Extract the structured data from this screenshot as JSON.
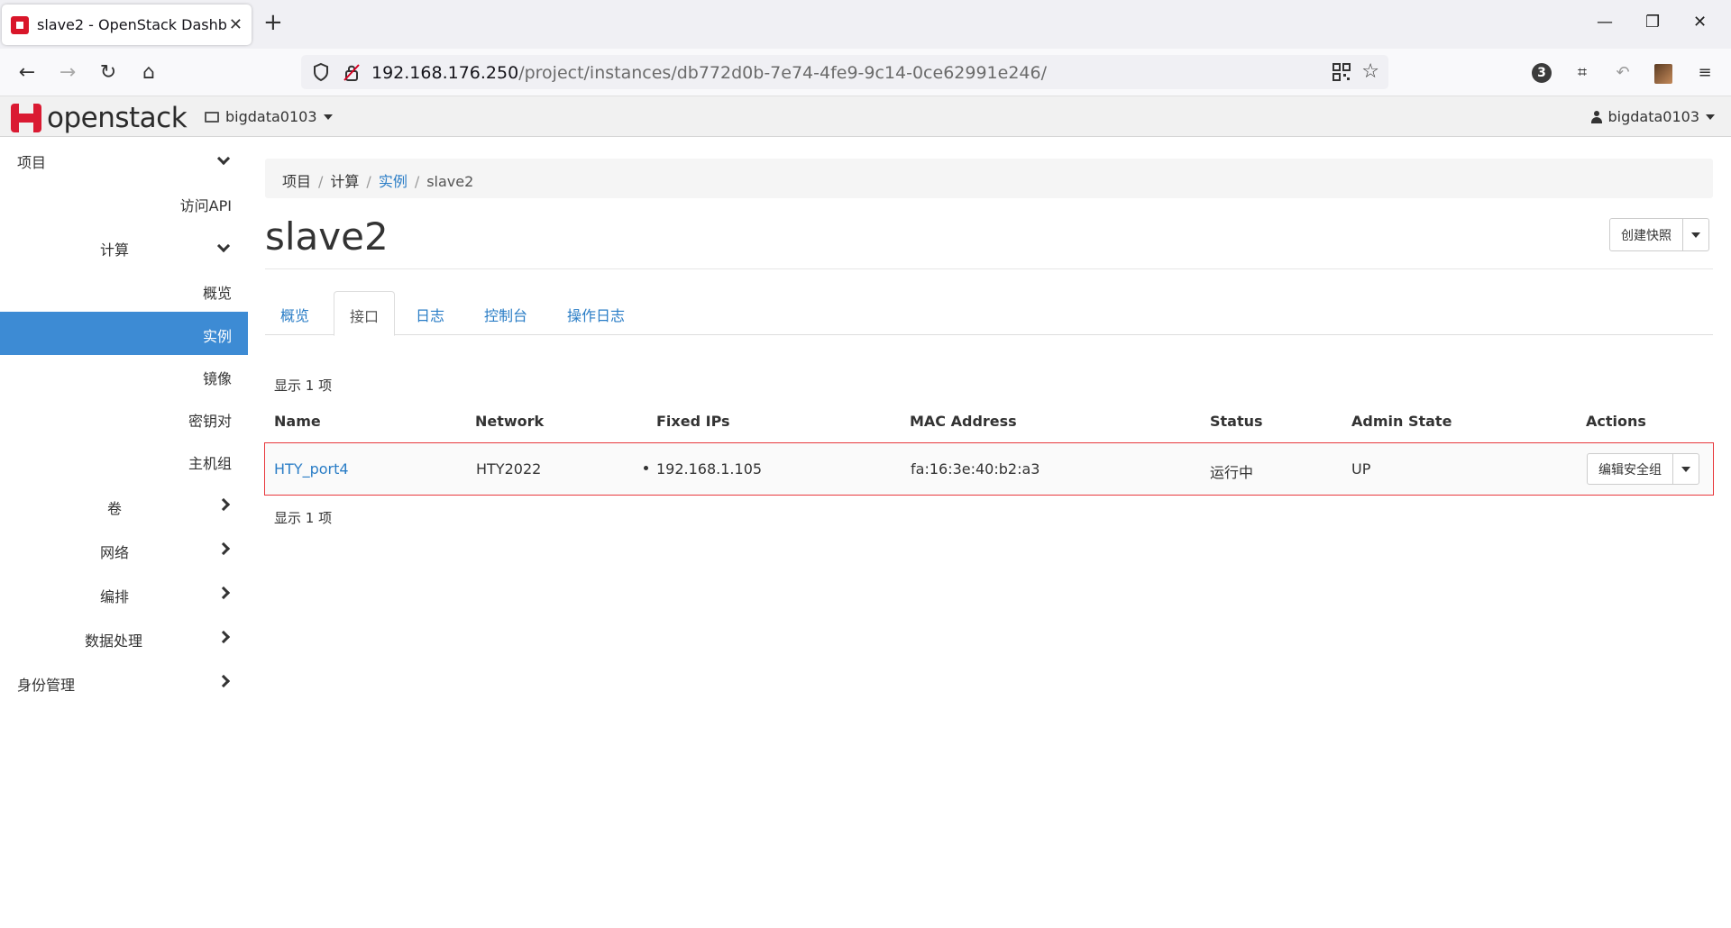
{
  "browser": {
    "tab_title": "slave2 - OpenStack Dashboard",
    "url_host": "192.168.176.250",
    "url_path": "/project/instances/db772d0b-7e74-4fe9-9c14-0ce62991e246/",
    "extension_badge": "3"
  },
  "header": {
    "logo_text": "openstack",
    "project": "bigdata0103",
    "user": "bigdata0103"
  },
  "sidebar": {
    "items": [
      {
        "label": "项目",
        "level": 0,
        "icon": "chevron-down-icon"
      },
      {
        "label": "访问API",
        "level": 2
      },
      {
        "label": "计算",
        "level": 1,
        "icon": "chevron-down-icon"
      },
      {
        "label": "概览",
        "level": 2
      },
      {
        "label": "实例",
        "level": 2,
        "active": true
      },
      {
        "label": "镜像",
        "level": 2
      },
      {
        "label": "密钥对",
        "level": 2
      },
      {
        "label": "主机组",
        "level": 2
      },
      {
        "label": "卷",
        "level": 1,
        "icon": "chevron-right-icon"
      },
      {
        "label": "网络",
        "level": 1,
        "icon": "chevron-right-icon"
      },
      {
        "label": "编排",
        "level": 1,
        "icon": "chevron-right-icon"
      },
      {
        "label": "数据处理",
        "level": 1,
        "icon": "chevron-right-icon"
      },
      {
        "label": "身份管理",
        "level": 0,
        "icon": "chevron-right-icon"
      }
    ]
  },
  "breadcrumb": [
    "项目",
    "计算",
    "实例",
    "slave2"
  ],
  "page": {
    "title": "slave2",
    "snapshot_button": "创建快照"
  },
  "tabs": [
    "概览",
    "接口",
    "日志",
    "控制台",
    "操作日志"
  ],
  "active_tab": "接口",
  "table": {
    "count_top": "显示 1 项",
    "count_bottom": "显示 1 项",
    "columns": [
      "Name",
      "Network",
      "Fixed IPs",
      "MAC Address",
      "Status",
      "Admin State",
      "Actions"
    ],
    "rows": [
      {
        "name": "HTY_port4",
        "network": "HTY2022",
        "fixed_ip": "192.168.1.105",
        "mac": "fa:16:3e:40:b2:a3",
        "status": "运行中",
        "admin_state": "UP",
        "action": "编辑安全组"
      }
    ]
  },
  "colors": {
    "accent": "#3d8bd4",
    "link": "#2a7dc6",
    "highlight_border": "#e8383d",
    "brand": "#da1a32"
  }
}
